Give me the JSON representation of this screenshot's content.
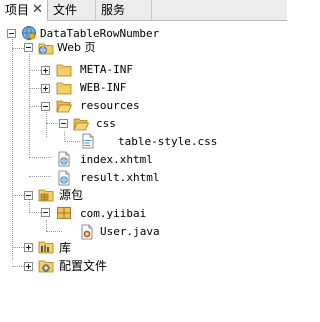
{
  "tabs": [
    {
      "label": "项目",
      "close": "✕",
      "active": true
    },
    {
      "label": "文件",
      "active": false
    },
    {
      "label": "服务",
      "active": false
    }
  ],
  "tree": {
    "root": "DataTableRowNumber",
    "web_pages": "Web 页",
    "meta_inf": "META-INF",
    "web_inf": "WEB-INF",
    "resources": "resources",
    "css": "css",
    "table_style": "table-style.css",
    "index": "index.xhtml",
    "result": "result.xhtml",
    "source_packages": "源包",
    "package": "com.yiibai",
    "user_java": "User.java",
    "libraries": "库",
    "config_files": "配置文件"
  }
}
